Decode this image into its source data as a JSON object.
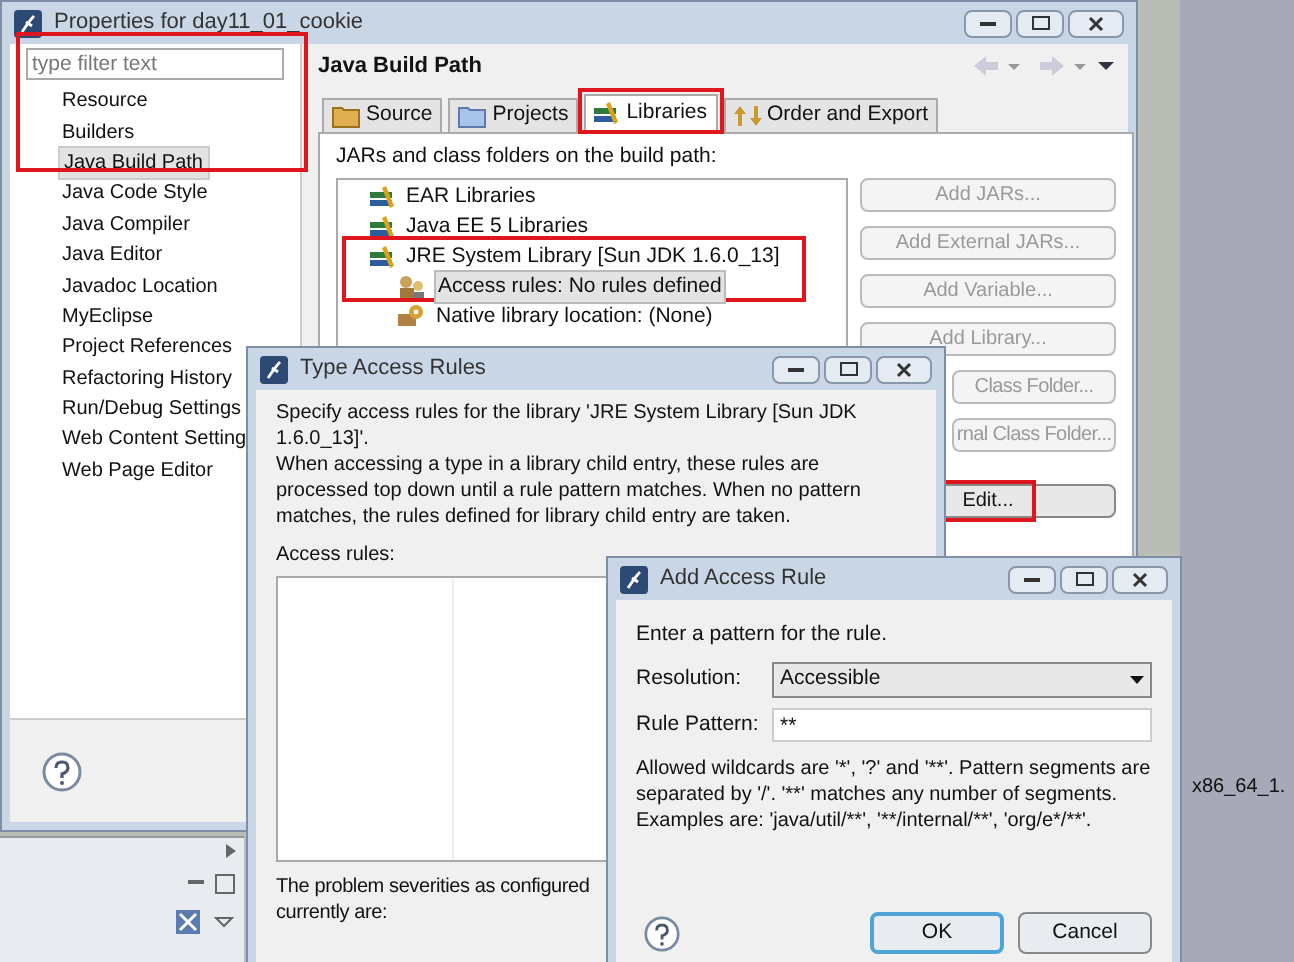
{
  "properties_window": {
    "title": "Properties for day11_01_cookie",
    "filter": {
      "placeholder": "type filter text"
    },
    "nav_items": [
      {
        "label": "Resource",
        "selected": false
      },
      {
        "label": "Builders",
        "selected": false
      },
      {
        "label": "Java Build Path",
        "selected": true
      },
      {
        "label": "Java Code Style",
        "selected": false
      },
      {
        "label": "Java Compiler",
        "selected": false
      },
      {
        "label": "Java Editor",
        "selected": false
      },
      {
        "label": "Javadoc Location",
        "selected": false
      },
      {
        "label": "MyEclipse",
        "selected": false
      },
      {
        "label": "Project References",
        "selected": false
      },
      {
        "label": "Refactoring History",
        "selected": false
      },
      {
        "label": "Run/Debug Settings",
        "selected": false
      },
      {
        "label": "Web Content Setting",
        "selected": false
      },
      {
        "label": "Web Page Editor",
        "selected": false
      }
    ],
    "page_title": "Java Build Path",
    "tabs": [
      {
        "label": "Source",
        "kind": "source",
        "selected": false
      },
      {
        "label": "Projects",
        "kind": "projects",
        "selected": false
      },
      {
        "label": "Libraries",
        "kind": "libraries",
        "selected": true
      },
      {
        "label": "Order and Export",
        "kind": "order",
        "selected": false
      }
    ],
    "libraries_caption": "JARs and class folders on the build path:",
    "libraries": [
      {
        "label": "EAR Libraries",
        "kind": "library",
        "selected": false
      },
      {
        "label": "Java EE 5 Libraries",
        "kind": "library",
        "selected": false
      },
      {
        "label": "JRE System Library [Sun JDK 1.6.0_13]",
        "kind": "library",
        "selected": false,
        "children": [
          {
            "label": "Access rules: No rules defined",
            "kind": "rules",
            "selected": true
          },
          {
            "label": "Native library location: (None)",
            "kind": "native",
            "selected": false
          }
        ]
      }
    ],
    "buttons": [
      {
        "label": "Add JARs...",
        "disabled": true
      },
      {
        "label": "Add External JARs...",
        "disabled": true
      },
      {
        "label": "Add Variable...",
        "disabled": true
      },
      {
        "label": "Add Library...",
        "disabled": true
      },
      {
        "label": "Class Folder...",
        "disabled": true
      },
      {
        "label": "rnal Class Folder...",
        "disabled": true
      },
      {
        "label": "Edit...",
        "disabled": false
      }
    ]
  },
  "access_rules_dialog": {
    "title": "Type Access Rules",
    "description": "Specify access rules for the library 'JRE System Library [Sun JDK 1.6.0_13]'.",
    "explanation": "When accessing a type in a library child entry, these rules are processed top down until a rule pattern matches. When no pattern matches, the rules defined for library child entry are taken.",
    "rules_label": "Access rules:",
    "severity_lines": [
      "The problem severities as configured",
      "currently are:"
    ]
  },
  "add_rule_dialog": {
    "title": "Add Access Rule",
    "prompt": "Enter a pattern for the rule.",
    "resolution": {
      "label": "Resolution:",
      "value": "Accessible"
    },
    "pattern": {
      "label": "Rule Pattern:",
      "value": "**"
    },
    "hint": "Allowed wildcards are '*', '?' and '**'. Pattern segments are separated by '/'. '**' matches any number of segments. Examples are: 'java/util/**', '**/internal/**', 'org/e*/**'.",
    "buttons": [
      {
        "label": "OK",
        "default": true
      },
      {
        "label": "Cancel",
        "default": false
      }
    ]
  },
  "background": {
    "text": "x86_64_1."
  }
}
